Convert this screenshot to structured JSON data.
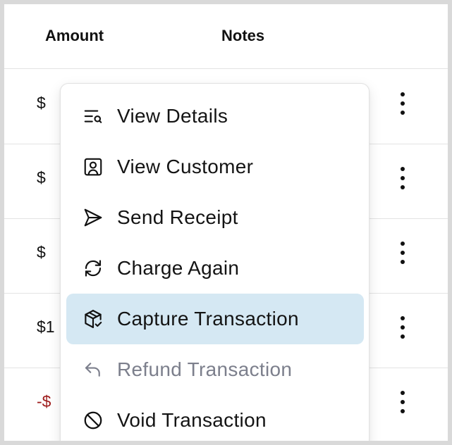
{
  "table": {
    "headers": {
      "amount": "Amount",
      "notes": "Notes"
    },
    "rows": [
      {
        "amount": "$",
        "negative": false
      },
      {
        "amount": "$",
        "negative": false
      },
      {
        "amount": "$",
        "negative": false
      },
      {
        "amount": "$1",
        "negative": false
      },
      {
        "amount": "-$",
        "negative": true
      }
    ]
  },
  "menu": {
    "items": [
      {
        "label": "View Details",
        "icon": "list-search-icon",
        "state": "normal"
      },
      {
        "label": "View Customer",
        "icon": "user-square-icon",
        "state": "normal"
      },
      {
        "label": "Send Receipt",
        "icon": "send-icon",
        "state": "normal"
      },
      {
        "label": "Charge Again",
        "icon": "refresh-icon",
        "state": "normal"
      },
      {
        "label": "Capture Transaction",
        "icon": "package-check-icon",
        "state": "highlighted"
      },
      {
        "label": "Refund Transaction",
        "icon": "undo-arrow-icon",
        "state": "disabled"
      },
      {
        "label": "Void Transaction",
        "icon": "ban-icon",
        "state": "normal"
      }
    ]
  },
  "colors": {
    "highlight": "#d5e8f3",
    "negative_amount": "#9e1c1c",
    "disabled_text": "#7c7f8c"
  }
}
